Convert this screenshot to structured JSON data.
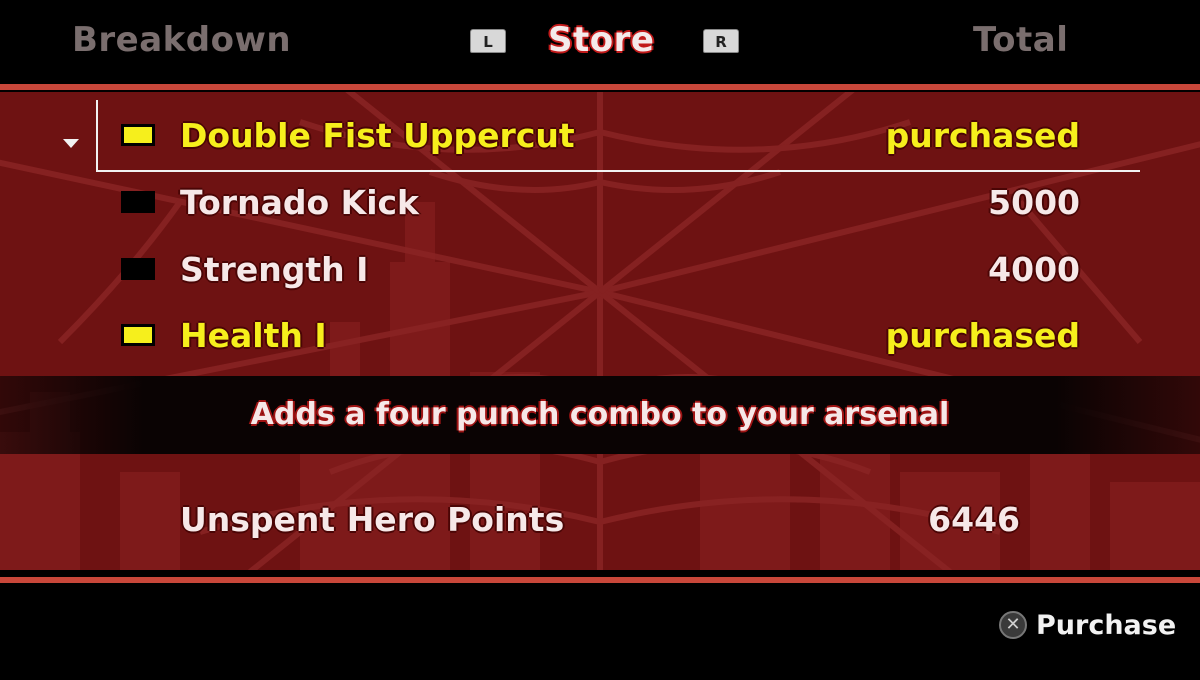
{
  "tabs": {
    "left_label": "Breakdown",
    "active_label": "Store",
    "right_label": "Total",
    "left_shoulder": "L",
    "right_shoulder": "R"
  },
  "store": {
    "items": [
      {
        "name": "Double Fist Uppercut",
        "price": "purchased",
        "owned": true,
        "selected": true
      },
      {
        "name": "Tornado Kick",
        "price": "5000",
        "owned": false,
        "selected": false
      },
      {
        "name": "Strength I",
        "price": "4000",
        "owned": false,
        "selected": false
      },
      {
        "name": "Health I",
        "price": "purchased",
        "owned": true,
        "selected": false
      }
    ],
    "description": "Adds a four punch combo to your arsenal",
    "points_label": "Unspent Hero Points",
    "points_value": "6446"
  },
  "footer": {
    "button_glyph": "✕",
    "action_label": "Purchase"
  },
  "colors": {
    "panel": "#6e1212",
    "accent_rule": "#c8473a",
    "owned_yellow": "#f6ef1c"
  }
}
